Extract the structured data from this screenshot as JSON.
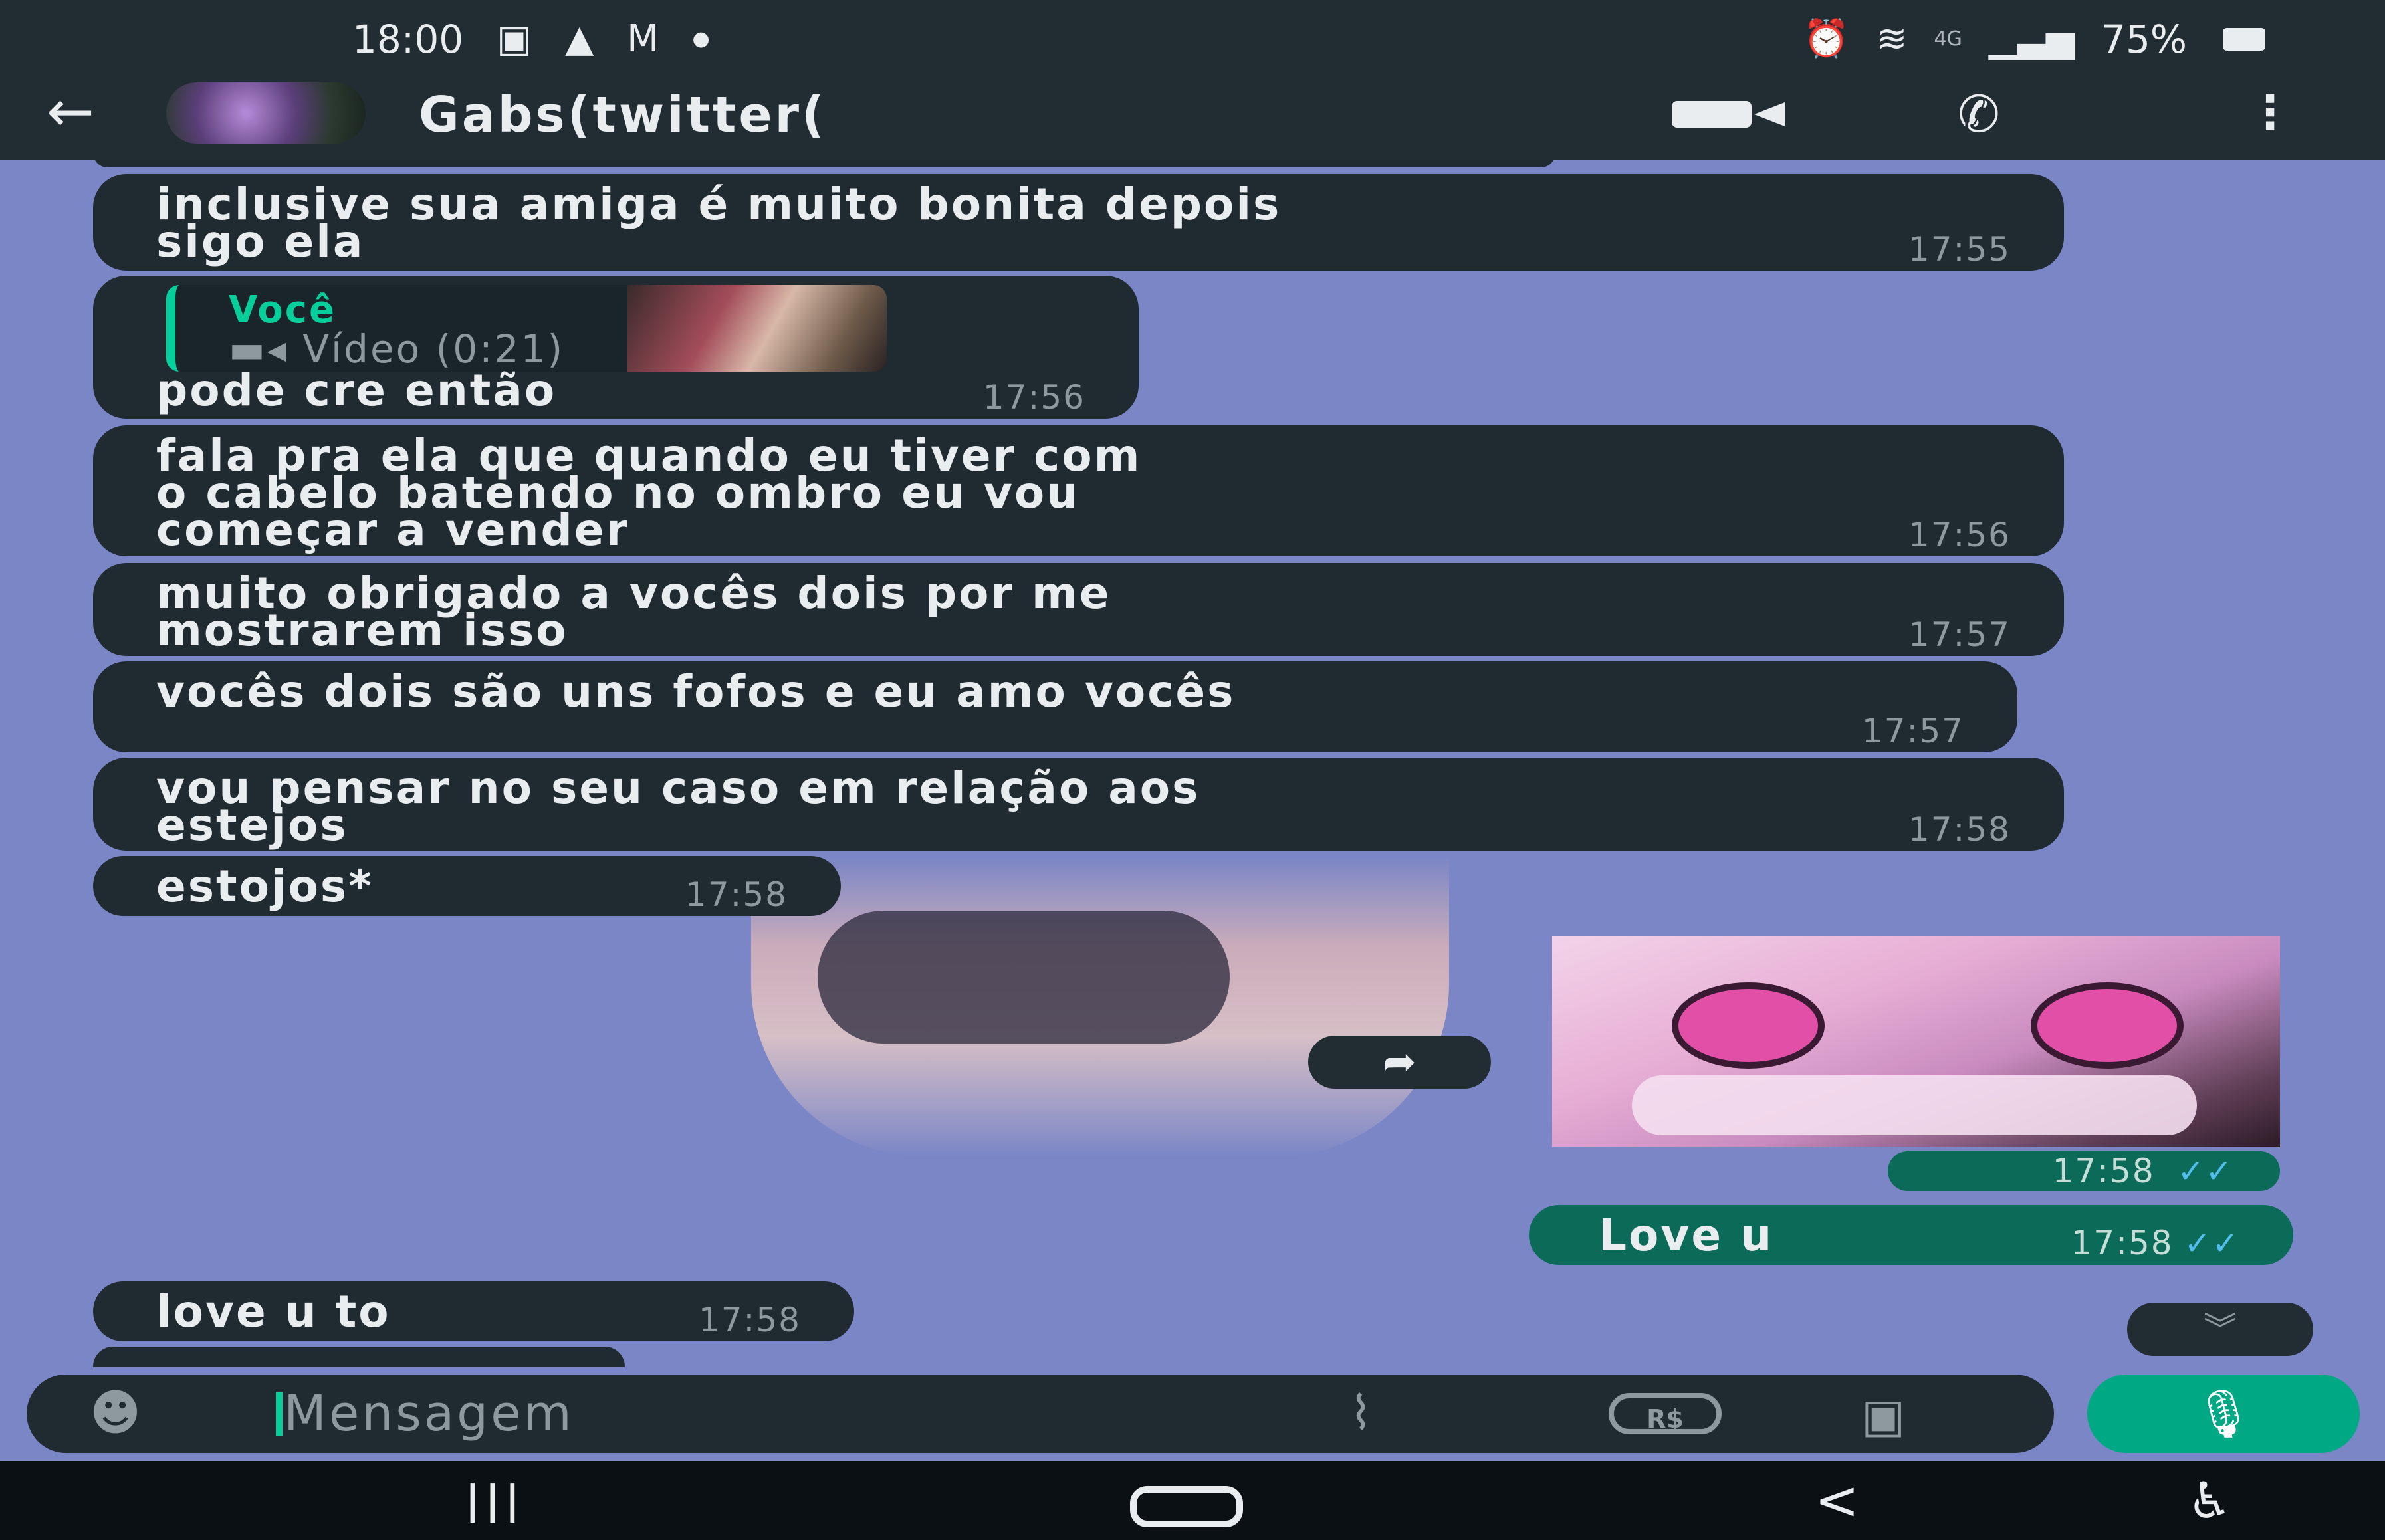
{
  "status_bar": {
    "time": "18:00",
    "left_icons": [
      "image-icon",
      "navigation-icon",
      "gmail-icon",
      "dot-icon"
    ],
    "network": "4G",
    "battery": "75%"
  },
  "header": {
    "contact_name": "Gabs(twitter(",
    "icons": [
      "back-arrow-icon",
      "video-call-icon",
      "phone-icon",
      "more-menu-icon"
    ]
  },
  "messages": [
    {
      "type": "received",
      "text": "inclusive sua amiga é muito bonita depois\nsigo ela",
      "time": "17:55"
    },
    {
      "type": "received",
      "reply_to": {
        "author": "Você",
        "content": "Vídeo (0:21)"
      },
      "text": "pode cre então",
      "time": "17:56"
    },
    {
      "type": "received",
      "text": "fala pra ela que quando eu tiver com\no cabelo batendo no ombro eu vou\ncomeçar a vender",
      "time": "17:56"
    },
    {
      "type": "received",
      "text": "muito obrigado a vocês dois por me\nmostrarem isso",
      "time": "17:57"
    },
    {
      "type": "received",
      "text": "vocês dois são uns fofos e eu amo vocês",
      "time": "17:57"
    },
    {
      "type": "received",
      "text": "vou pensar no seu caso em relação aos\nestejos",
      "time": "17:58"
    },
    {
      "type": "received",
      "text": "estojos*",
      "time": "17:58"
    },
    {
      "type": "sent_image",
      "time": "17:58",
      "ticks": "✓✓"
    },
    {
      "type": "sent",
      "text": "Love u",
      "time": "17:58",
      "ticks": "✓✓"
    },
    {
      "type": "received",
      "text": "love u to",
      "time": "17:58"
    }
  ],
  "input": {
    "placeholder": "Mensagem",
    "pay_label": "R$"
  },
  "colors": {
    "wallpaper": "#7b86c6",
    "header": "#222d33",
    "received_bubble": "#1f2b31",
    "sent_bubble": "#0b6b58",
    "accent": "#00a884",
    "read_ticks": "#53bdeb"
  }
}
